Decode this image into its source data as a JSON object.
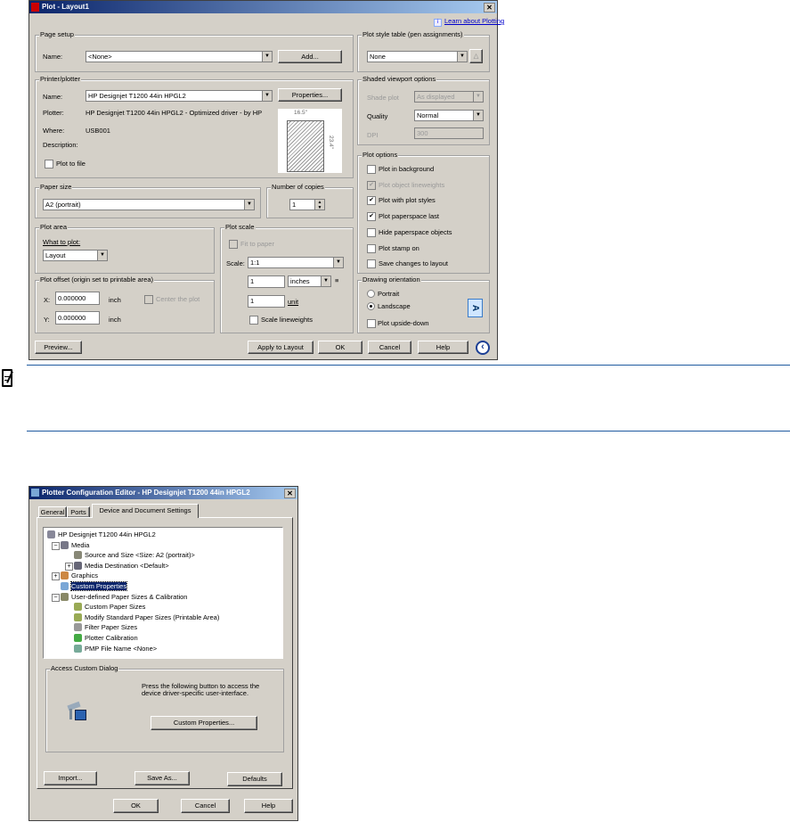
{
  "plot_dialog": {
    "title": "Plot - Layout1",
    "close": "✕",
    "learn_link": "Learn about Plotting",
    "page_setup": {
      "label": "Page setup",
      "name_label": "Name:",
      "name_value": "<None>",
      "add_button": "Add..."
    },
    "printer": {
      "label": "Printer/plotter",
      "name_label": "Name:",
      "name_value": "HP Designjet T1200 44in HPGL2",
      "properties_button": "Properties...",
      "plotter_label": "Plotter:",
      "plotter_value": "HP Designjet T1200 44in HPGL2 - Optimized driver - by HP",
      "where_label": "Where:",
      "where_value": "USB001",
      "description_label": "Description:",
      "plot_to_file": "Plot to file",
      "preview_width": "16.5\"",
      "preview_height": "23.4\""
    },
    "plot_style": {
      "label": "Plot style table (pen assignments)",
      "value": "None"
    },
    "shaded": {
      "label": "Shaded viewport options",
      "shade_label": "Shade plot",
      "shade_value": "As displayed",
      "quality_label": "Quality",
      "quality_value": "Normal",
      "dpi_label": "DPI",
      "dpi_value": "300"
    },
    "plot_options": {
      "label": "Plot options",
      "items": [
        {
          "label": "Plot in background",
          "checked": false,
          "disabled": false
        },
        {
          "label": "Plot object lineweights",
          "checked": true,
          "disabled": true
        },
        {
          "label": "Plot with plot styles",
          "checked": true,
          "disabled": false
        },
        {
          "label": "Plot paperspace last",
          "checked": true,
          "disabled": false
        },
        {
          "label": "Hide paperspace objects",
          "checked": false,
          "disabled": false
        },
        {
          "label": "Plot stamp on",
          "checked": false,
          "disabled": false
        },
        {
          "label": "Save changes to layout",
          "checked": false,
          "disabled": false
        }
      ]
    },
    "paper_size": {
      "label": "Paper size",
      "value": "A2 (portrait)"
    },
    "copies": {
      "label": "Number of copies",
      "value": "1"
    },
    "plot_area": {
      "label": "Plot area",
      "what_label": "What to plot:",
      "what_value": "Layout"
    },
    "plot_offset": {
      "label": "Plot offset (origin set to printable area)",
      "x_label": "X:",
      "x_value": "0.000000",
      "y_label": "Y:",
      "y_value": "0.000000",
      "unit": "inch",
      "center": "Center the plot"
    },
    "plot_scale": {
      "label": "Plot scale",
      "fit": "Fit to paper",
      "scale_label": "Scale:",
      "scale_value": "1:1",
      "value1": "1",
      "units": "inches",
      "equals": "≡",
      "value2": "1",
      "unit_label": "unit",
      "scale_lw": "Scale lineweights"
    },
    "orientation": {
      "label": "Drawing orientation",
      "portrait": "Portrait",
      "landscape": "Landscape",
      "upside": "Plot upside-down",
      "icon_letter": "A"
    },
    "buttons": {
      "preview": "Preview...",
      "apply": "Apply to Layout",
      "ok": "OK",
      "cancel": "Cancel",
      "help": "Help",
      "more": "‹"
    }
  },
  "config_dialog": {
    "title": "Plotter Configuration Editor - HP Designjet T1200 44in HPGL2",
    "close": "✕",
    "tabs": [
      "General",
      "Ports",
      "Device and Document Settings"
    ],
    "tree": [
      "HP Designjet T1200 44in HPGL2",
      "Media",
      "Source and Size <Size: A2 (portrait)>",
      "Media Destination <Default>",
      "Graphics",
      "Custom Properties",
      "User-defined Paper Sizes & Calibration",
      "Custom Paper Sizes",
      "Modify Standard Paper Sizes (Printable Area)",
      "Filter Paper Sizes",
      "Plotter Calibration",
      "PMP File Name <None>"
    ],
    "access": {
      "label": "Access Custom Dialog",
      "text1": "Press the following button to access the",
      "text2": "device driver-specific user-interface.",
      "button": "Custom Properties..."
    },
    "buttons": {
      "import": "Import...",
      "save_as": "Save As...",
      "defaults": "Defaults",
      "ok": "OK",
      "cancel": "Cancel",
      "help": "Help"
    }
  }
}
